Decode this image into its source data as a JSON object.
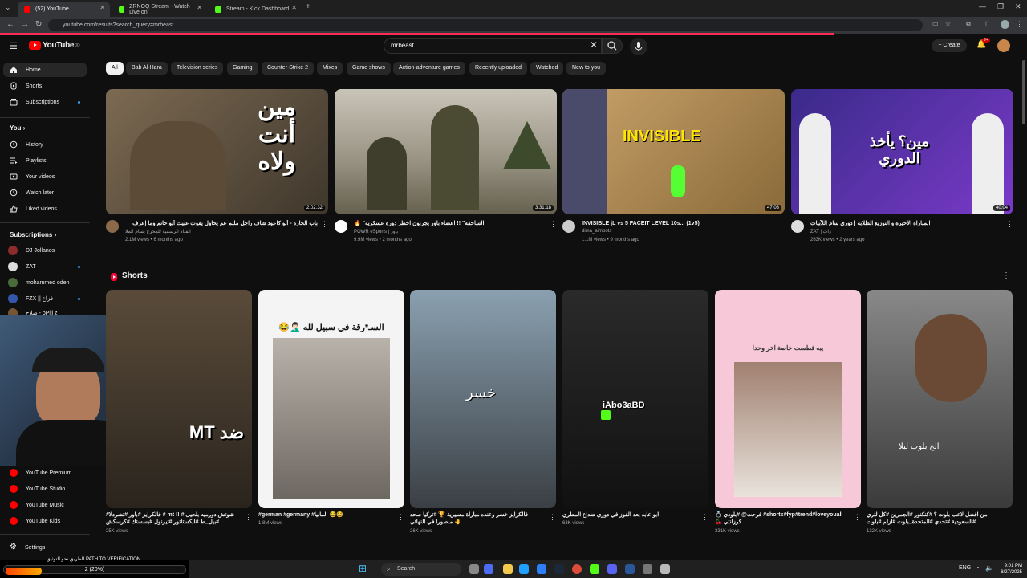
{
  "browser": {
    "tabs": [
      {
        "title": "(52) YouTube",
        "active": true
      },
      {
        "title": "ZRNOQ Stream - Watch Live on",
        "active": false
      },
      {
        "title": "Stream - Kick Dashboard",
        "active": false
      }
    ],
    "url": "youtube.com/results?search_query=mrbeast"
  },
  "header": {
    "logo_text": "YouTube",
    "logo_sup": "JO",
    "search_value": "mrbeast",
    "create_label": "Create",
    "notification_count": "9+"
  },
  "chips": [
    "All",
    "Bab Al-Hara",
    "Television series",
    "Gaming",
    "Counter-Strike 2",
    "Mixes",
    "Game shows",
    "Action-adventure games",
    "Recently uploaded",
    "Watched",
    "New to you"
  ],
  "sidebar": {
    "main": [
      {
        "label": "Home",
        "icon": "home-icon"
      },
      {
        "label": "Shorts",
        "icon": "shorts-icon"
      },
      {
        "label": "Subscriptions",
        "icon": "subscriptions-icon"
      }
    ],
    "you_heading": "You",
    "you_items": [
      {
        "label": "History",
        "icon": "history-icon"
      },
      {
        "label": "Playlists",
        "icon": "playlists-icon"
      },
      {
        "label": "Your videos",
        "icon": "your-videos-icon"
      },
      {
        "label": "Watch later",
        "icon": "watch-later-icon"
      },
      {
        "label": "Liked videos",
        "icon": "liked-icon"
      }
    ],
    "subs_heading": "Subscriptions",
    "subs": [
      {
        "label": "DJ Jollanos",
        "color": "#8b2b2b"
      },
      {
        "label": "ZAT",
        "color": "#dddddd"
      },
      {
        "label": "mohammed oden",
        "color": "#4a6b3a"
      },
      {
        "label": "FZX || فزاع",
        "color": "#3355aa"
      },
      {
        "label": "صلاح - oPiii z",
        "color": "#775533"
      }
    ],
    "more_from": [
      {
        "label": "YouTube Premium"
      },
      {
        "label": "YouTube Studio"
      },
      {
        "label": "YouTube Music"
      },
      {
        "label": "YouTube Kids"
      }
    ],
    "settings_label": "Settings"
  },
  "videos": [
    {
      "title": "باب الحارة - أبو كاعود شاف راجل ملثم عم يحاول يفوت عبيت أبو حاتم وما إعرف لأبو هي ... صاحب البيت",
      "channel": "القناة الرسمية للمخرج بسام الملا",
      "stats": "2.1M views • 6 months ago",
      "duration": "2:02:32",
      "thumb_text": "مين أنت ولاه",
      "av": "#8a6a4a"
    },
    {
      "title": "🔥 \"الساحقة\" !! اعضاء باور يجربون اخطر دورة عسكرية",
      "channel": "POWR eSports | باور",
      "stats": "9.9M views • 2 months ago",
      "duration": "3:31:18",
      "thumb_text": "",
      "av": "#ffffff"
    },
    {
      "title": "INVISIBLE jL vs 5 FACEIT LEVEL 10s... (1v5)",
      "channel": "dima_aimbots",
      "stats": "1.1M views • 9 months ago",
      "duration": "47:03",
      "thumb_text": "INVISIBLE",
      "av": "#cccccc"
    },
    {
      "title": "المباراة الأخيرة و التوزيع الطلابة | دوري سام اللآبيات",
      "channel": "ZAT | زات",
      "stats": "263K views • 2 years ago",
      "duration": "40:04",
      "thumb_text": "مين؟ يأخذ الدوري",
      "av": "#dddddd"
    }
  ],
  "shorts_heading": "Shorts",
  "shorts": [
    {
      "title": "#فالكرايز #باور #تشردلا # mt !! شوتش دورمیه بلحیی # #بیل_ط #انکستاتور #تیرنول #بسستك #کرسکش",
      "stats": "25K views",
      "thumb_text": "MT ضد"
    },
    {
      "title": "#german #germany #المانيا 😂😂",
      "stats": "1.8M views",
      "thumb_text": "السـ*رقة في سبيل لله 🤦🏻‍♂️😂"
    },
    {
      "title": "فالكرايز خسر وعنده مباراة مسيرية 🏆 #تركيا صحد منصورا في النهائي 🤚",
      "stats": "26K views",
      "thumb_text": "خسر"
    },
    {
      "title": "ابو عابد بعد الفوز في دوري ضداع المطري",
      "stats": "63K views",
      "thumb_text": "iAbo3aBD"
    },
    {
      "title": "💍 فرحت@ #بلودي #shorts#fyp#trend#loveyouall🍒 كرزانتي",
      "stats": "331K views",
      "thumb_text": "يبه فطست خاصة اخر وحدا"
    },
    {
      "title": "من افضل لاعب بلوت ؟ #كنكنور #الجمرين #كل لتري #السعودية #تحدي #المتحدة_بلوت #ازلم #بلوت",
      "stats": "132K views",
      "thumb_text": "الخ بلوت لبلا"
    }
  ],
  "webcam": {
    "progress_label": "2 (20%)",
    "progress_fraction": 0.2,
    "overlay_text": "الطريق نحو التوثيق PATH TO VERIFICATION"
  },
  "taskbar": {
    "search_placeholder": "Search",
    "lang": "ENG",
    "time": "9:01 PM",
    "date": "8/27/2025"
  }
}
